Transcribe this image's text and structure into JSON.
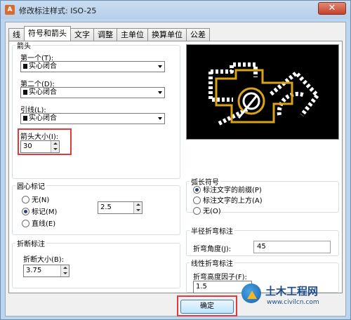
{
  "window": {
    "title": "修改标注样式: ISO-25",
    "close_glyph": "✕",
    "app_icon_glyph": "A"
  },
  "tabs": [
    {
      "label": "线",
      "active": false
    },
    {
      "label": "符号和箭头",
      "active": true
    },
    {
      "label": "文字",
      "active": false
    },
    {
      "label": "调整",
      "active": false
    },
    {
      "label": "主单位",
      "active": false
    },
    {
      "label": "换算单位",
      "active": false
    },
    {
      "label": "公差",
      "active": false
    }
  ],
  "arrowheads": {
    "legend": "箭头",
    "first_label": "第一个(T):",
    "first_value": "实心闭合",
    "second_label": "第二个(D):",
    "second_value": "实心闭合",
    "leader_label": "引线(L):",
    "leader_value": "实心闭合",
    "size_label": "箭头大小(I):",
    "size_value": "30"
  },
  "center_marks": {
    "legend": "圆心标记",
    "options": [
      "无(N)",
      "标记(M)",
      "直线(E)"
    ],
    "selected_index": 1,
    "size_value": "2.5"
  },
  "dim_break": {
    "legend": "折断标注",
    "size_label": "折断大小(B):",
    "size_value": "3.75"
  },
  "arc_length": {
    "legend": "弧长符号",
    "options": [
      "标注文字的前缀(P)",
      "标注文字的上方(A)",
      "无(O)"
    ],
    "selected_index": 0
  },
  "radius_jog": {
    "legend": "半径折弯标注",
    "angle_label": "折弯角度(J):",
    "angle_value": "45"
  },
  "linear_jog": {
    "legend": "线性折弯标注",
    "factor_label": "折弯高度因子(F):",
    "factor_value": "1.5"
  },
  "buttons": {
    "ok_label": "确定"
  },
  "watermark": {
    "title": "土木工程网",
    "url": "www.civilcn.com"
  },
  "colors": {
    "highlight": "#e23a3a",
    "preview_bg": "#000000",
    "preview_lines": "#ffffff",
    "preview_accent": "#d9a21b"
  }
}
